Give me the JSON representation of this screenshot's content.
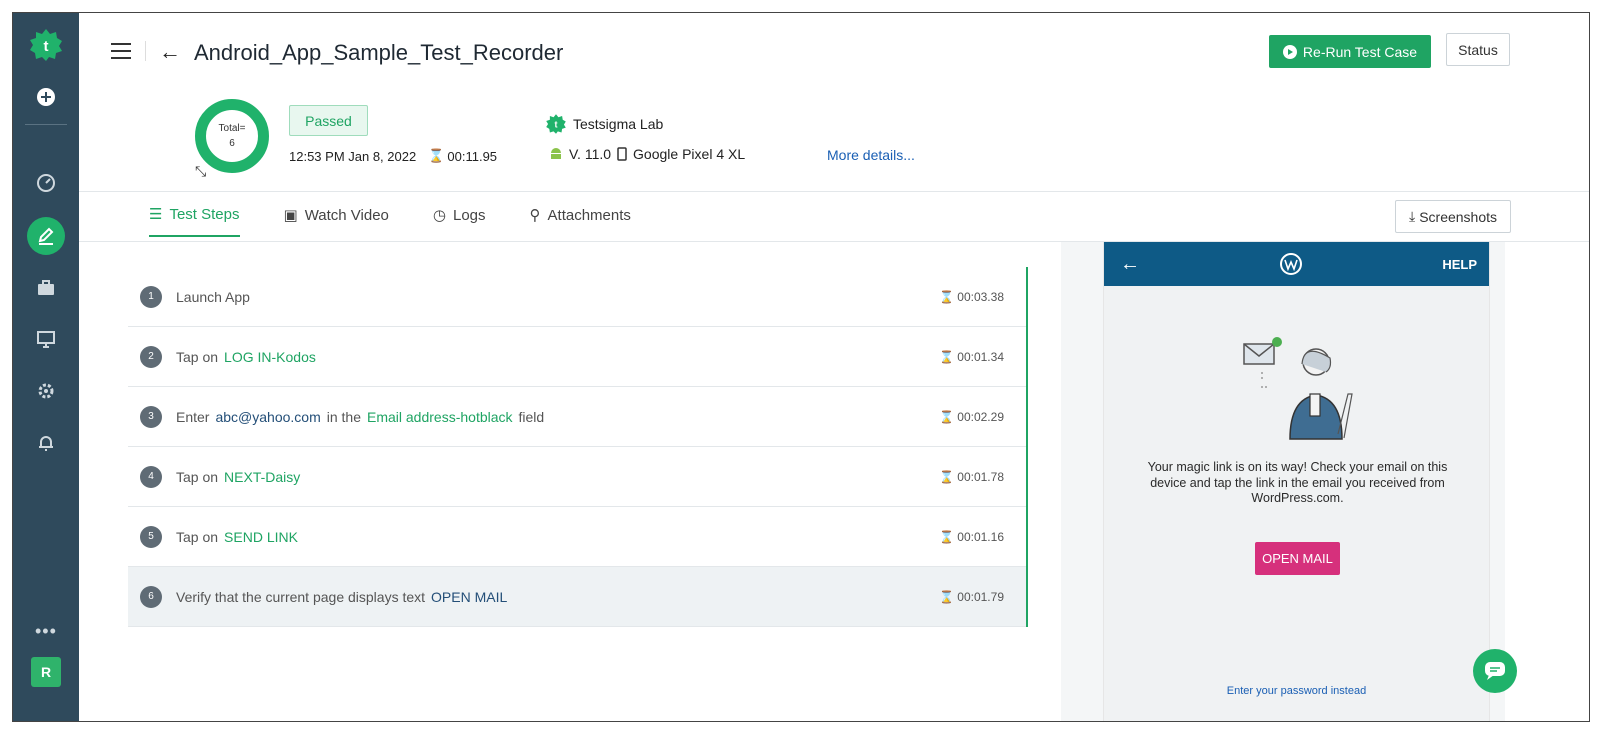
{
  "header": {
    "title": "Android_App_Sample_Test_Recorder",
    "rerun_label": "Re-Run Test Case",
    "status_label": "Status"
  },
  "summary": {
    "total_label": "Total=",
    "total_value": "6",
    "result": "Passed",
    "datetime": "12:53 PM Jan 8, 2022",
    "duration": "00:11.95",
    "lab": "Testsigma Lab",
    "os_version": "V. 11.0",
    "device": "Google Pixel 4 XL",
    "more_details": "More details..."
  },
  "tabs": [
    {
      "label": "Test Steps",
      "icon": "list-icon",
      "active": true
    },
    {
      "label": "Watch Video",
      "icon": "video-icon",
      "active": false
    },
    {
      "label": "Logs",
      "icon": "clock-icon",
      "active": false
    },
    {
      "label": "Attachments",
      "icon": "paperclip-icon",
      "active": false
    }
  ],
  "screenshots_label": "Screenshots",
  "steps": [
    {
      "num": "1",
      "parts": [
        {
          "text": "Launch App",
          "style": "plain"
        }
      ],
      "time": "00:03.38"
    },
    {
      "num": "2",
      "parts": [
        {
          "text": "Tap on",
          "style": "plain"
        },
        {
          "text": "LOG IN-Kodos",
          "style": "green"
        }
      ],
      "time": "00:01.34"
    },
    {
      "num": "3",
      "parts": [
        {
          "text": "Enter",
          "style": "plain"
        },
        {
          "text": "abc@yahoo.com",
          "style": "navy"
        },
        {
          "text": "in the",
          "style": "plain"
        },
        {
          "text": "Email address-hotblack",
          "style": "green"
        },
        {
          "text": "field",
          "style": "plain"
        }
      ],
      "time": "00:02.29"
    },
    {
      "num": "4",
      "parts": [
        {
          "text": "Tap on",
          "style": "plain"
        },
        {
          "text": "NEXT-Daisy",
          "style": "green"
        }
      ],
      "time": "00:01.78"
    },
    {
      "num": "5",
      "parts": [
        {
          "text": "Tap on",
          "style": "plain"
        },
        {
          "text": "SEND LINK",
          "style": "green"
        }
      ],
      "time": "00:01.16"
    },
    {
      "num": "6",
      "parts": [
        {
          "text": "Verify that the current page displays text",
          "style": "plain"
        },
        {
          "text": "OPEN MAIL",
          "style": "navy"
        }
      ],
      "time": "00:01.79"
    }
  ],
  "phone": {
    "help": "HELP",
    "message": "Your magic link is on its way! Check your email on this device and tap the link in the email you received from WordPress.com.",
    "open_mail": "OPEN MAIL",
    "password_link": "Enter your password instead"
  },
  "sidebar": {
    "avatar_initial": "R"
  },
  "colors": {
    "brand_green": "#20b26b",
    "sidebar": "#2f4a5c",
    "phone_bar": "#0e5a86",
    "open_mail": "#d6307c"
  }
}
